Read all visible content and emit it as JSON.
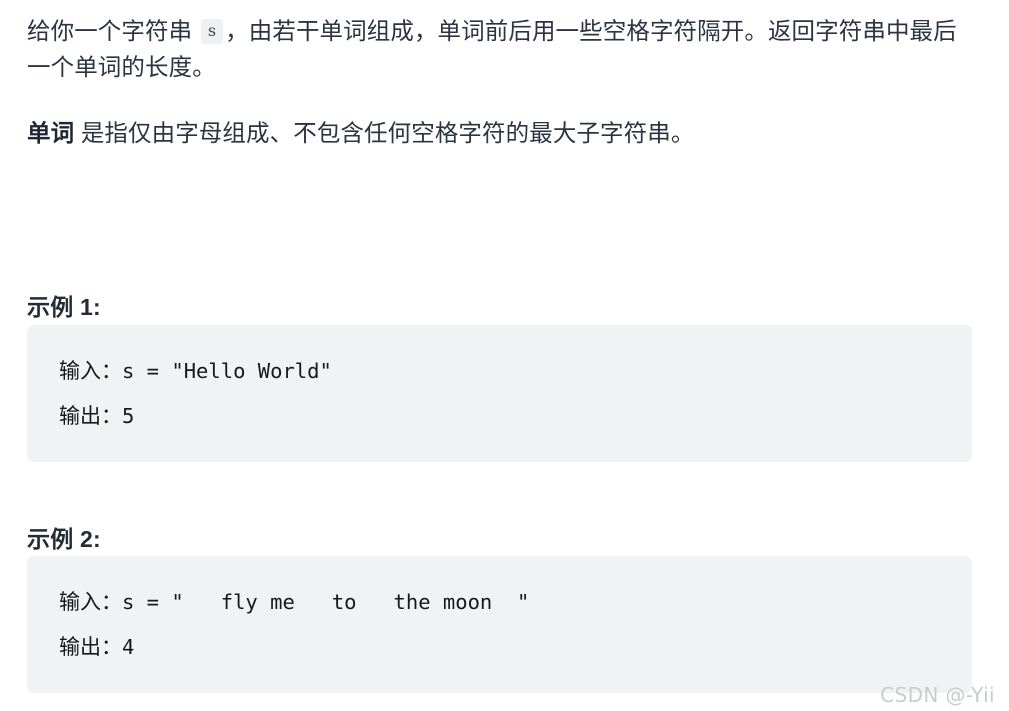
{
  "colors": {
    "background": "#ffffff",
    "text": "#2b3440",
    "heading": "#252c38",
    "code_block_bg": "#f1f2f4",
    "inline_code_bg": "#eff0f2",
    "code_text": "#16181d",
    "watermark": "#c9ccd1"
  },
  "description": {
    "paragraph1_before": "给你一个字符串 ",
    "inline_code": "s",
    "paragraph1_after": "，由若干单词组成，单词前后用一些空格字符隔开。返回字符串中最后一个单词的长度。",
    "paragraph2_bold": "单词",
    "paragraph2_rest": " 是指仅由字母组成、不包含任何空格字符的最大子字符串。"
  },
  "examples": [
    {
      "heading": "示例 1:",
      "input_label": "输入：",
      "input_value": "s = \"Hello World\"",
      "output_label": "输出：",
      "output_value": "5"
    },
    {
      "heading": "示例 2:",
      "input_label": "输入：",
      "input_value": "s = \"   fly me   to   the moon  \"",
      "output_label": "输出：",
      "output_value": "4"
    }
  ],
  "watermark": "CSDN @-Yii"
}
